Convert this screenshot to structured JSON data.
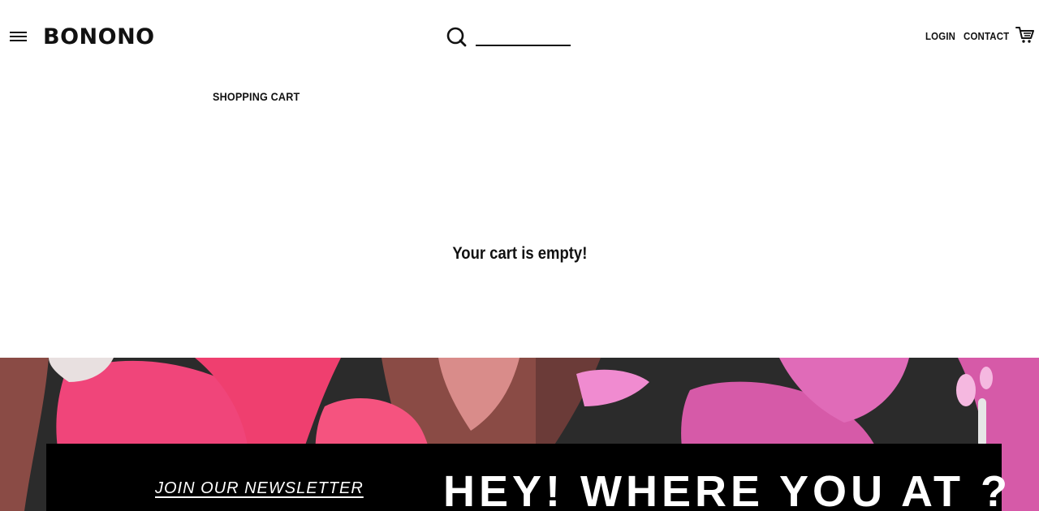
{
  "header": {
    "logo": "BONONO",
    "menu_icon": "hamburger-menu-icon",
    "search": {
      "icon": "search-icon",
      "value": "",
      "placeholder": ""
    },
    "nav": {
      "login": "LOGIN",
      "contact": "CONTACT"
    },
    "cart_icon": "shopping-cart-icon"
  },
  "main": {
    "title": "SHOPPING CART",
    "empty_message": "Your cart is empty!"
  },
  "footer_banner": {
    "newsletter_link": "JOIN OUR NEWSLETTER",
    "headline": "HEY! WHERE YOU AT ?",
    "colors": {
      "box": "#000000",
      "pink": "#f0457a",
      "magenta": "#d65aa8",
      "dark": "#2b2b2b",
      "brown": "#8a4b45"
    }
  }
}
